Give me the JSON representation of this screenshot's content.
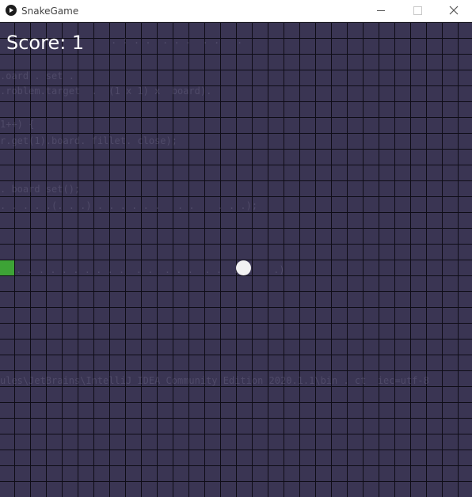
{
  "window": {
    "title": "SnakeGame",
    "controls": {
      "minimize_icon": "minimize-icon",
      "maximize_icon": "maximize-icon",
      "close_icon": "close-icon"
    }
  },
  "game": {
    "score_text": "Score: 1",
    "score_value": 1,
    "colors": {
      "background": "#3a3553",
      "grid_lines": "#0e0c16",
      "snake": "#3da336",
      "food": "#f2f2f2",
      "score_text": "#ffffff"
    }
  }
}
